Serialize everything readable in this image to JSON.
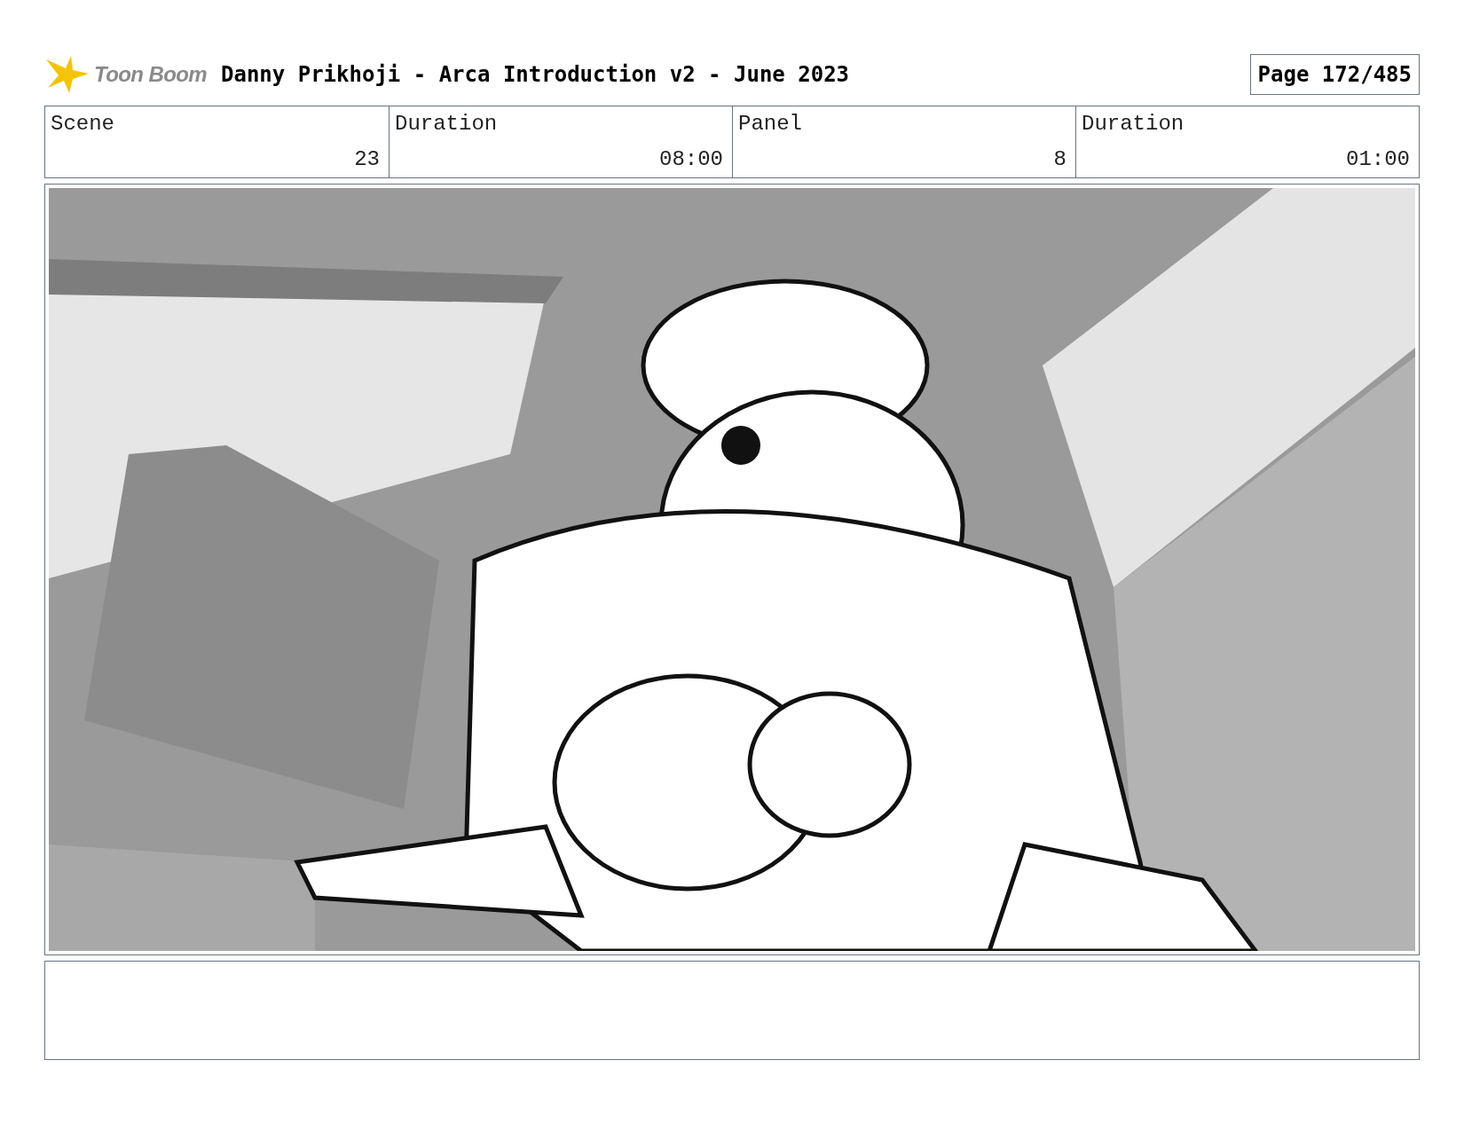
{
  "header": {
    "logo_text": "Toon Boom",
    "title": "Danny Prikhoji - Arca Introduction v2 - June 2023",
    "page": "Page 172/485"
  },
  "info": {
    "labels": [
      "Scene",
      "Duration",
      "Panel",
      "Duration"
    ],
    "values": [
      "23",
      "08:00",
      "8",
      "01:00"
    ]
  }
}
